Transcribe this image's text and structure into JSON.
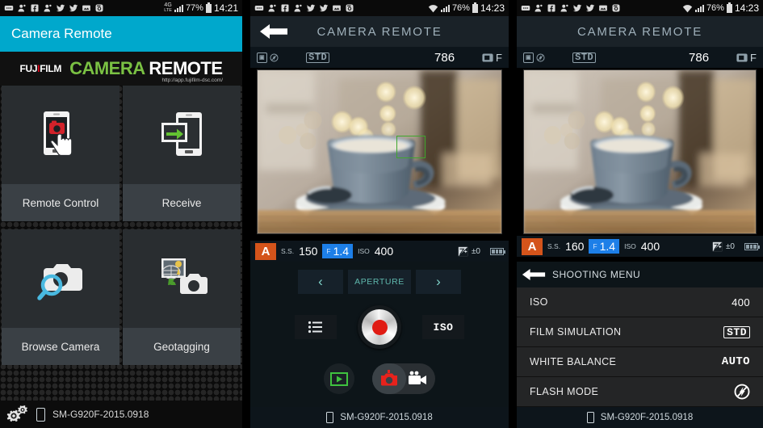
{
  "panel1": {
    "statusbar": {
      "icons": [
        "message-icon",
        "contact-icon",
        "facebook-icon",
        "contact-icon",
        "twitter-icon",
        "twitter-icon",
        "image-icon",
        "instagram-icon"
      ],
      "network": "4G",
      "network_sub": "LTE",
      "battery_percent": "77%",
      "time": "14:21"
    },
    "app_title": "Camera Remote",
    "banner": {
      "brand": "FUJ",
      "brand_dot": "I",
      "brand_rest": "FILM",
      "title_green": "CAMERA",
      "title_white": "REMOTE",
      "url": "http://app.fujifilm-dsc.com/"
    },
    "tiles": [
      {
        "label": "Remote Control",
        "icon": "phone-touch-camera-icon"
      },
      {
        "label": "Receive",
        "icon": "transfer-to-phone-icon"
      },
      {
        "label": "Browse Camera",
        "icon": "camera-magnifier-icon"
      },
      {
        "label": "Geotagging",
        "icon": "geotag-camera-icon"
      }
    ],
    "footer": {
      "device": "SM-G920F-2015.0918",
      "gear_icon": "settings-gears-icon",
      "phone_icon": "phone-icon"
    },
    "accent_color": "#00a8cc",
    "tile_bg": "#292d30",
    "tile_label_bg": "#3a4045"
  },
  "panel2": {
    "statusbar": {
      "icons": [
        "message-icon",
        "contact-icon",
        "facebook-icon",
        "contact-icon",
        "twitter-icon",
        "twitter-icon",
        "image-icon",
        "instagram-icon"
      ],
      "network": "wifi",
      "battery_percent": "76%",
      "time": "14:23"
    },
    "title": "CAMERA REMOTE",
    "back_icon": "back-arrow-icon",
    "info_bar": {
      "flash_icon": "flash-off-icon",
      "film_sim": "STD",
      "frames_remaining": "786",
      "media_icon": "sd-card-icon",
      "media_label": "F"
    },
    "photo": {
      "alt": "coffee-cup-bokeh-photo",
      "af_box": "focus-frame"
    },
    "exif": {
      "mode": "A",
      "ss_label": "S.S.",
      "ss_value": "150",
      "aperture_label": "F",
      "aperture_value": "1.4",
      "iso_label": "ISO",
      "iso_value": "400",
      "ev_icon": "exposure-compensation-icon",
      "ev_value": "±0",
      "battery_icon": "camera-battery-icon"
    },
    "aperture_control": {
      "prev": "‹",
      "label": "APERTURE",
      "next": "›"
    },
    "controls": {
      "menu_button": "shooting-menu-icon",
      "shutter_button": "shutter-release-button",
      "iso_button": "ISO",
      "playback_button": "playback-icon",
      "photo_mode": "still-camera-icon",
      "video_mode": "movie-camera-icon"
    },
    "footer": {
      "device": "SM-G920F-2015.0918",
      "phone_icon": "phone-icon"
    },
    "aperture_chip_color": "#1d7fe8",
    "mode_color": "#d4541b",
    "teal_text": "#5fb8ad"
  },
  "panel3": {
    "statusbar": {
      "icons": [
        "message-icon",
        "contact-icon",
        "facebook-icon",
        "contact-icon",
        "twitter-icon",
        "twitter-icon",
        "image-icon",
        "instagram-icon"
      ],
      "network": "wifi",
      "battery_percent": "76%",
      "time": "14:23"
    },
    "title": "CAMERA REMOTE",
    "info_bar": {
      "flash_icon": "flash-off-icon",
      "film_sim": "STD",
      "frames_remaining": "786",
      "media_icon": "sd-card-icon",
      "media_label": "F"
    },
    "photo": {
      "alt": "coffee-cup-bokeh-photo"
    },
    "exif": {
      "mode": "A",
      "ss_label": "S.S.",
      "ss_value": "160",
      "aperture_label": "F",
      "aperture_value": "1.4",
      "iso_label": "ISO",
      "iso_value": "400",
      "ev_icon": "exposure-compensation-icon",
      "ev_value": "±0",
      "battery_icon": "camera-battery-icon"
    },
    "menu": {
      "back_icon": "back-arrow-icon",
      "header": "SHOOTING MENU",
      "rows": [
        {
          "label": "ISO",
          "value": "400",
          "value_type": "text"
        },
        {
          "label": "FILM SIMULATION",
          "value": "STD",
          "value_type": "badge"
        },
        {
          "label": "WHITE BALANCE",
          "value": "AUTO",
          "value_type": "mono"
        },
        {
          "label": "FLASH MODE",
          "value": "",
          "value_type": "flash-off-icon"
        }
      ]
    },
    "footer": {
      "device": "SM-G920F-2015.0918",
      "phone_icon": "phone-icon"
    }
  }
}
